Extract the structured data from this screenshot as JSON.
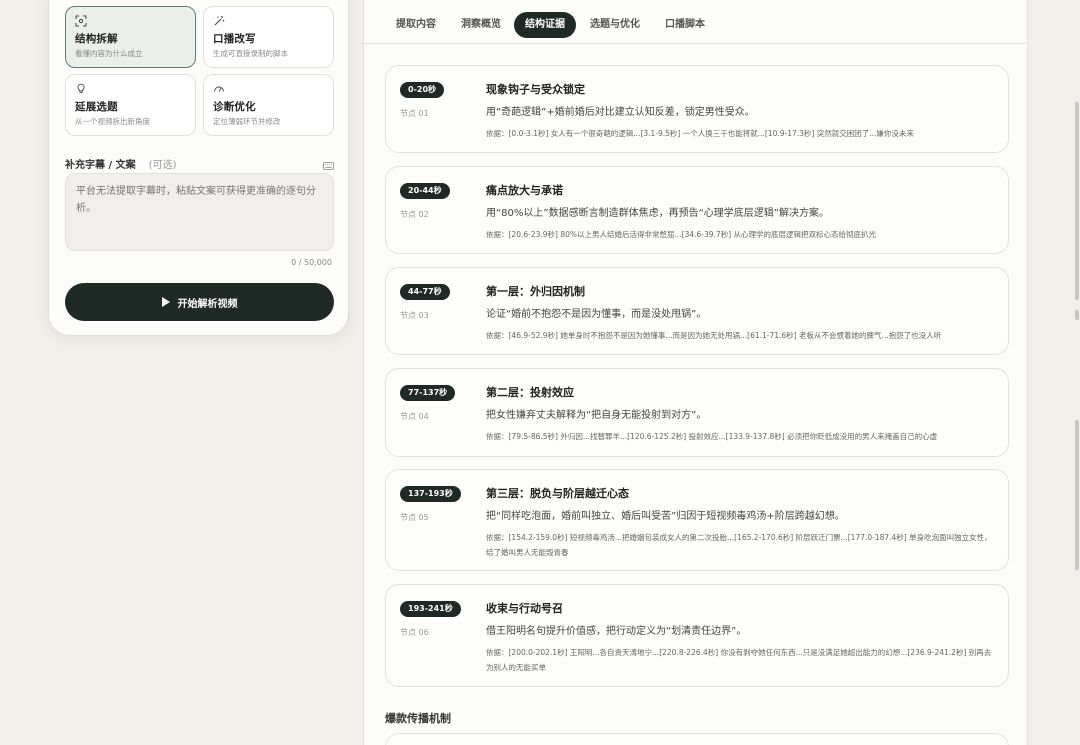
{
  "modes": [
    {
      "title": "结构拆解",
      "desc": "看懂内容为什么成立",
      "icon": "scan-icon",
      "active": true
    },
    {
      "title": "口播改写",
      "desc": "生成可直接录制的脚本",
      "icon": "magic-wand-icon",
      "active": false
    },
    {
      "title": "延展选题",
      "desc": "从一个视频拆出新角度",
      "icon": "lightbulb-icon",
      "active": false
    },
    {
      "title": "诊断优化",
      "desc": "定位薄弱环节并修改",
      "icon": "gauge-icon",
      "active": false
    }
  ],
  "subtitle_section": {
    "label": "补充字幕 / 文案",
    "optional": "(可选)",
    "placeholder": "平台无法提取字幕时，粘贴文案可获得更准确的逐句分析。",
    "char_count": "0 / 50,000"
  },
  "start_button": "开始解析视频",
  "tabs": [
    "提取内容",
    "洞察概览",
    "结构证据",
    "选题与优化",
    "口播脚本"
  ],
  "active_tab": "结构证据",
  "nodes": [
    {
      "time": "0-20秒",
      "label": "节点 01",
      "title": "现象钩子与受众锁定",
      "desc": "用“奇葩逻辑”+婚前婚后对比建立认知反差，锁定男性受众。",
      "basis": "依据：[0.0-3.1秒] 女人有一个很奇葩的逻辑...[3.1-9.5秒] 一个人换三千也能将就...[10.9-17.3秒] 突然就交困团了...嫌你没未来"
    },
    {
      "time": "20-44秒",
      "label": "节点 02",
      "title": "痛点放大与承诺",
      "desc": "用“80%以上”数据感断言制造群体焦虑，再预告“心理学底层逻辑”解决方案。",
      "basis": "依据：[20.6-23.9秒] 80%以上男人结婚后活得非常憋屈...[34.6-39.7秒] 从心理学的底层逻辑把双标心态给彻底扒光"
    },
    {
      "time": "44-77秒",
      "label": "节点 03",
      "title": "第一层：外归因机制",
      "desc": "论证“婚前不抱怨不是因为懂事，而是没处甩锅”。",
      "basis": "依据：[46.9-52.9秒] 她单身时不抱怨不是因为她懂事...而是因为她无处甩锅...[61.1-71.6秒] 老板从不会惯着她的脾气...抱怨了也没人听"
    },
    {
      "time": "77-137秒",
      "label": "节点 04",
      "title": "第二层：投射效应",
      "desc": "把女性嫌弃丈夫解释为“把自身无能投射到对方”。",
      "basis": "依据：[79.5-86.5秒] 外归因...找替罪羊...[120.6-125.2秒] 投射效应...[133.9-137.8秒] 必须把你贬低成没用的男人来掩盖自己的心虚"
    },
    {
      "time": "137-193秒",
      "label": "节点 05",
      "title": "第三层：脱负与阶层越迁心态",
      "desc": "把“同样吃泡面，婚前叫独立、婚后叫受苦”归因于短视频毒鸡汤+阶层跨越幻想。",
      "basis": "依据：[154.2-159.0秒] 短视频毒鸡汤...把婚姻包装成女人的第二次投胎...[165.2-170.6秒] 阶层跃迁门票...[177.0-187.4秒] 单身吃泡面叫独立女性，结了婚叫男人无能毁青春"
    },
    {
      "time": "193-241秒",
      "label": "节点 06",
      "title": "收束与行动号召",
      "desc": "借王阳明名句提升价值感，把行动定义为“划清责任边界”。",
      "basis": "依据：[200.0-202.1秒] 王阳明...各自责天涛地宁...[220.8-226.4秒] 你没有剥夺她任何东西...只是没满足她超出能力的幻想...[236.9-241.2秒] 别再去为别人的无能买单"
    }
  ],
  "section_title": "爆款传播机制"
}
